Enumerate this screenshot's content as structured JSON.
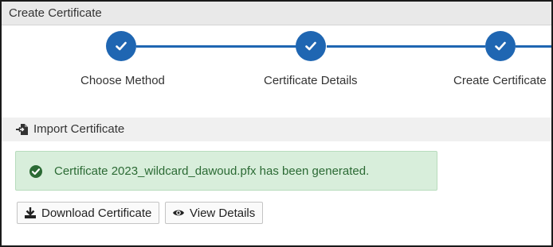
{
  "window": {
    "title": "Create Certificate"
  },
  "stepper": {
    "steps": [
      {
        "label": "Choose Method",
        "status": "complete"
      },
      {
        "label": "Certificate Details",
        "status": "complete"
      },
      {
        "label": "Create Certificate",
        "status": "complete"
      }
    ],
    "accent_color": "#1f66b2"
  },
  "section": {
    "title": "Import Certificate",
    "icon": "import-icon"
  },
  "alert": {
    "type": "success",
    "icon": "check-circle-icon",
    "message": "Certificate 2023_wildcard_dawoud.pfx has been generated.",
    "background_color": "#d8eedb",
    "text_color": "#2b6a34"
  },
  "actions": {
    "download_label": "Download Certificate",
    "download_icon": "download-icon",
    "view_label": "View Details",
    "view_icon": "eye-icon"
  }
}
